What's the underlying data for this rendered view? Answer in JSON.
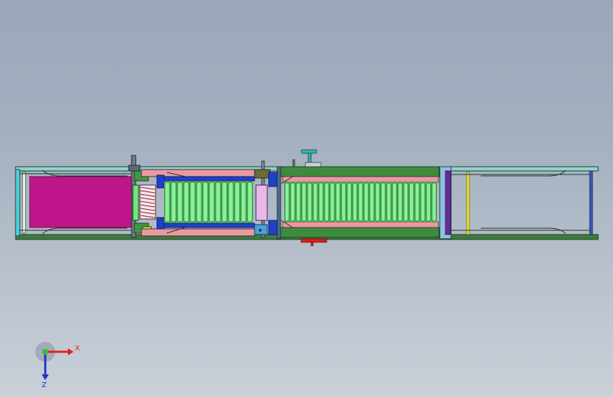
{
  "colors": {
    "frame_green": "#2e6b2e",
    "frame_dark": "#1f3d1f",
    "frame_cyan": "#8fd4cf",
    "magenta": "#c0168c",
    "roller_green": "#6ee87a",
    "pink": "#e79aa2",
    "blue": "#2041c8",
    "yellow": "#e8e820",
    "purple": "#6a2a9a",
    "red": "#d82020",
    "teal": "#30b8a8"
  },
  "triad": {
    "x_label": "X",
    "z_label": "Z",
    "x_icon": "x-axis-arrow-icon",
    "z_icon": "z-axis-arrow-icon"
  }
}
